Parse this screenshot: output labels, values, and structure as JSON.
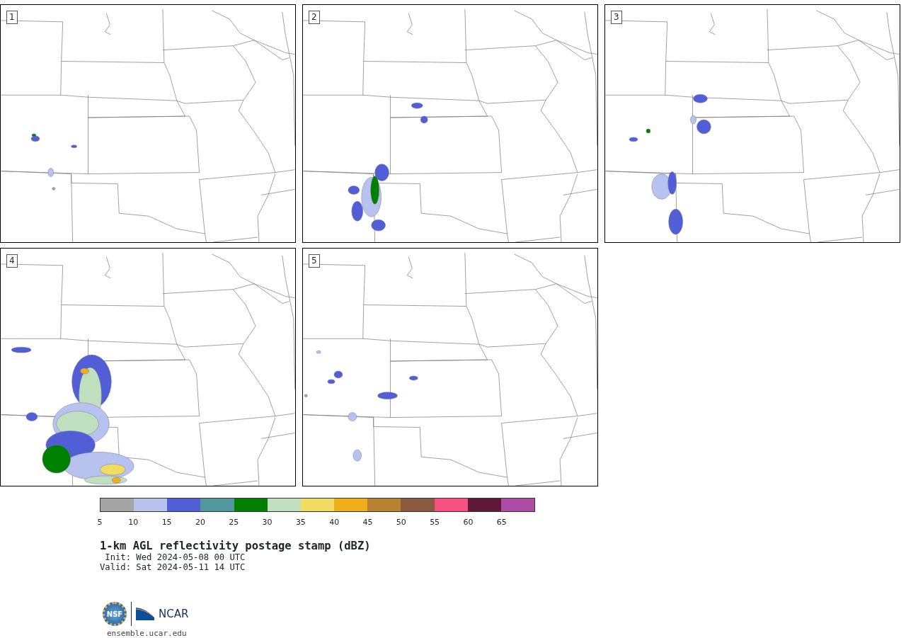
{
  "panels": [
    {
      "label": "1"
    },
    {
      "label": "2"
    },
    {
      "label": "3"
    },
    {
      "label": "4"
    },
    {
      "label": "5"
    }
  ],
  "colorbar": {
    "bins": [
      {
        "label": "5",
        "color": "#a4a4a4"
      },
      {
        "label": "10",
        "color": "#b8c2ee"
      },
      {
        "label": "15",
        "color": "#525ed6"
      },
      {
        "label": "20",
        "color": "#52969e"
      },
      {
        "label": "25",
        "color": "#008000"
      },
      {
        "label": "30",
        "color": "#bfdfbf"
      },
      {
        "label": "35",
        "color": "#f0dc60"
      },
      {
        "label": "40",
        "color": "#f0ae18"
      },
      {
        "label": "45",
        "color": "#b88232"
      },
      {
        "label": "50",
        "color": "#8a5a3e"
      },
      {
        "label": "55",
        "color": "#f5507e"
      },
      {
        "label": "60",
        "color": "#601838"
      },
      {
        "label": "65",
        "color": "#ac4ca4"
      }
    ]
  },
  "title": "1-km AGL reflectivity postage stamp (dBZ)",
  "init": " Init: Wed 2024-05-08 00 UTC",
  "valid": "Valid: Sat 2024-05-11 14 UTC",
  "logo": {
    "nsf": "NSF",
    "ncar": "NCAR",
    "site": "ensemble.ucar.edu"
  }
}
